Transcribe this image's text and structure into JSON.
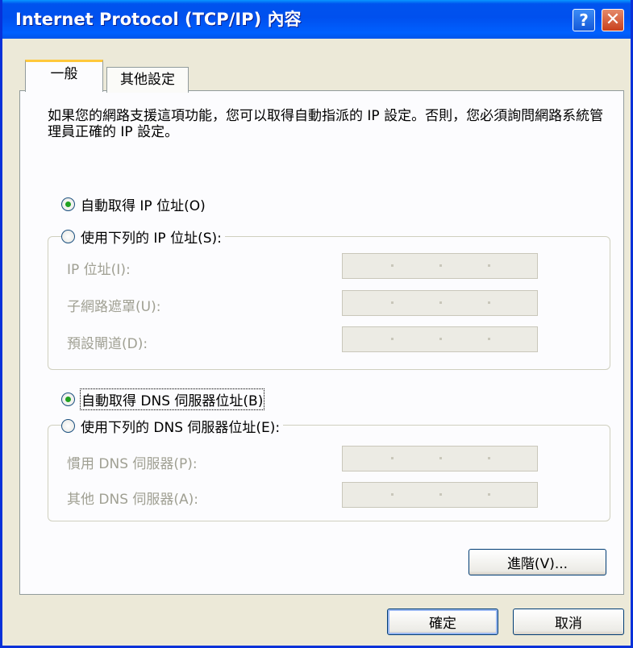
{
  "window": {
    "title": "Internet Protocol (TCP/IP) 內容",
    "help_button": "?",
    "close_button": "✕"
  },
  "tabs": [
    {
      "label": "一般",
      "selected": true
    },
    {
      "label": "其他設定",
      "selected": false
    }
  ],
  "description": "如果您的網路支援這項功能，您可以取得自動指派的 IP 設定。否則，您必須詢問網路系統管理員正確的 IP 設定。",
  "ip_section": {
    "auto_option": {
      "label": "自動取得 IP 位址(O)",
      "selected": true
    },
    "manual_option": {
      "label": "使用下列的 IP 位址(S):",
      "selected": false
    },
    "fields": [
      {
        "label": "IP 位址(I):",
        "value": ". . ."
      },
      {
        "label": "子網路遮罩(U):",
        "value": ". . ."
      },
      {
        "label": "預設閘道(D):",
        "value": ". . ."
      }
    ]
  },
  "dns_section": {
    "auto_option": {
      "label": "自動取得 DNS 伺服器位址(B)",
      "selected": true
    },
    "manual_option": {
      "label": "使用下列的 DNS 伺服器位址(E):",
      "selected": false
    },
    "fields": [
      {
        "label": "慣用 DNS 伺服器(P):",
        "value": ". . ."
      },
      {
        "label": "其他 DNS 伺服器(A):",
        "value": ". . ."
      }
    ]
  },
  "buttons": {
    "advanced": "進階(V)...",
    "ok": "確定",
    "cancel": "取消"
  },
  "colors": {
    "titlebar": "#0055ea",
    "dialog_bg": "#ece9d8",
    "panel_bg": "#fcfcfe",
    "disabled_text": "#a0a093",
    "tab_highlight": "#ffc83c"
  }
}
